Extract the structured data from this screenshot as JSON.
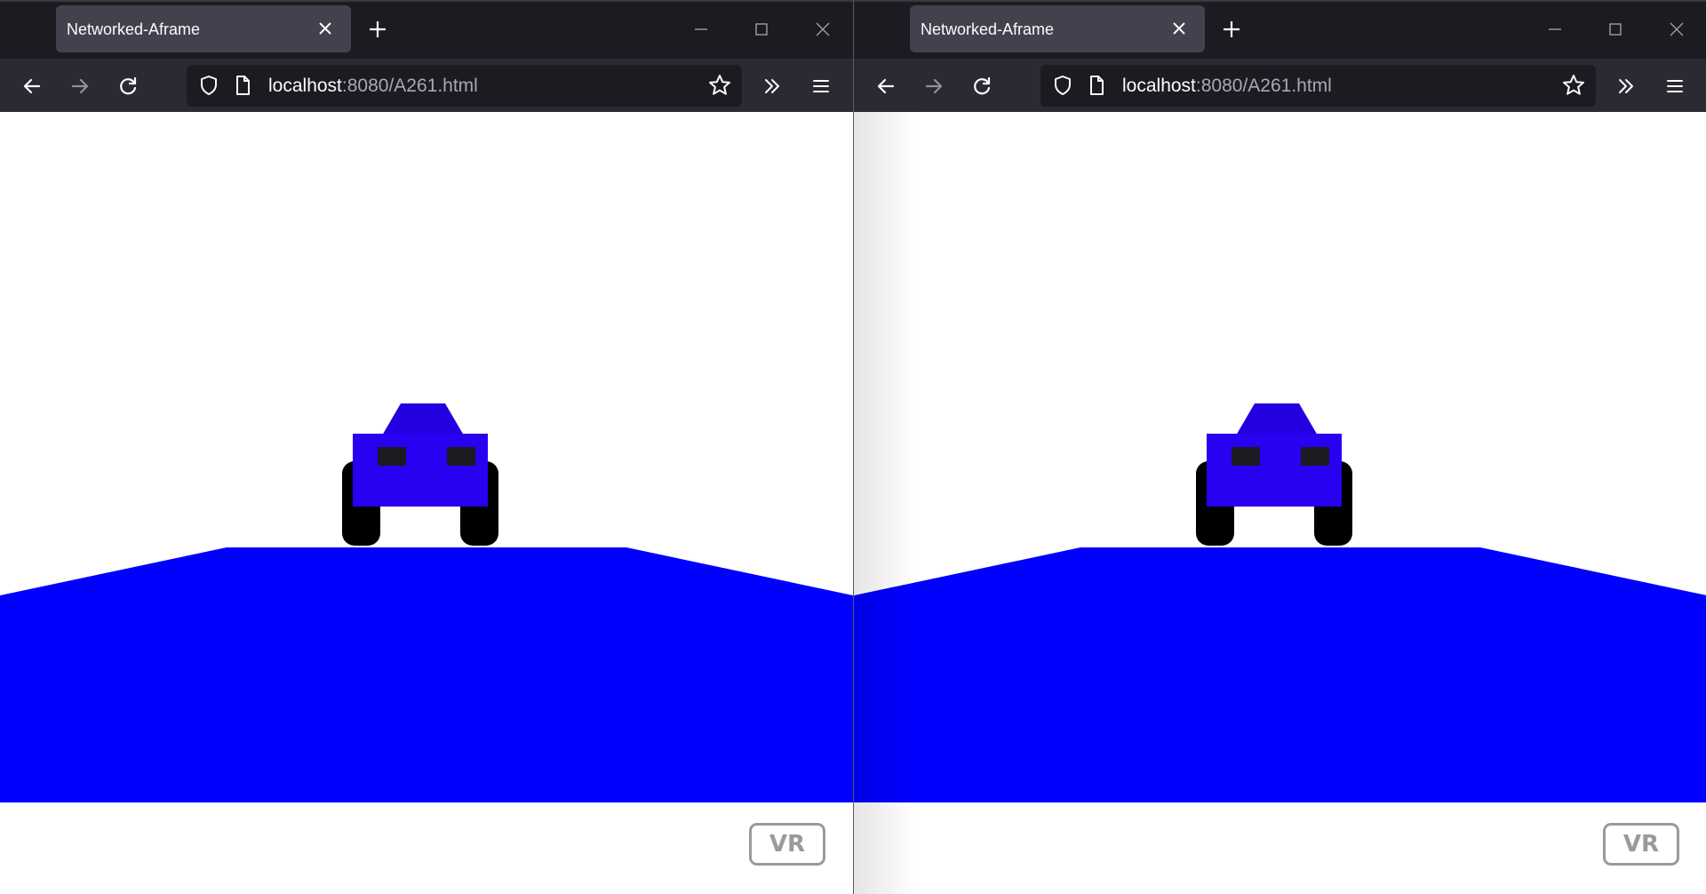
{
  "windows": [
    {
      "tab_title": "Networked-Aframe",
      "url_host": "localhost",
      "url_path": ":8080/A261.html",
      "vr_button_label": "VR"
    },
    {
      "tab_title": "Networked-Aframe",
      "url_host": "localhost",
      "url_path": ":8080/A261.html",
      "vr_button_label": "VR"
    }
  ],
  "colors": {
    "chrome_dark": "#1c1b22",
    "toolbar": "#2b2a33",
    "active_tab": "#42414d",
    "ground": "#0000ff",
    "car_body": "#2a00f0",
    "car_roof": "#2200e0",
    "wheel": "#000000",
    "car_window": "#1c1b22",
    "sky": "#ffffff"
  },
  "scene": {
    "objects": [
      "blue-ground-plane",
      "blue-car"
    ]
  }
}
